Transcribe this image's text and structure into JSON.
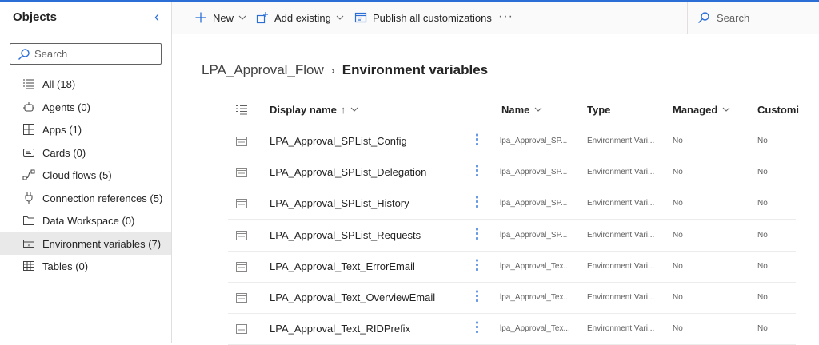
{
  "sidebar": {
    "title": "Objects",
    "search_placeholder": "Search",
    "items": [
      {
        "label": "All (18)",
        "icon": "list-icon"
      },
      {
        "label": "Agents (0)",
        "icon": "agent-icon"
      },
      {
        "label": "Apps (1)",
        "icon": "apps-icon"
      },
      {
        "label": "Cards (0)",
        "icon": "cards-icon"
      },
      {
        "label": "Cloud flows (5)",
        "icon": "flow-icon"
      },
      {
        "label": "Connection references (5)",
        "icon": "plug-icon"
      },
      {
        "label": "Data Workspace (0)",
        "icon": "folder-icon"
      },
      {
        "label": "Environment variables (7)",
        "icon": "env-variable-icon",
        "active": true
      },
      {
        "label": "Tables (0)",
        "icon": "table-icon"
      }
    ]
  },
  "toolbar": {
    "new_label": "New",
    "add_existing_label": "Add existing",
    "publish_label": "Publish all customizations",
    "more_label": "···",
    "search_placeholder": "Search"
  },
  "breadcrumb": {
    "parent": "LPA_Approval_Flow",
    "separator": "›",
    "current": "Environment variables"
  },
  "grid": {
    "columns": {
      "display_name": "Display name",
      "display_name_sort": "↑",
      "name": "Name",
      "type": "Type",
      "managed": "Managed",
      "customizable": "Customi"
    },
    "rows": [
      {
        "display_name": "LPA_Approval_SPList_Config",
        "name": "lpa_Approval_SP...",
        "type": "Environment Vari...",
        "managed": "No",
        "customizable": "No"
      },
      {
        "display_name": "LPA_Approval_SPList_Delegation",
        "name": "lpa_Approval_SP...",
        "type": "Environment Vari...",
        "managed": "No",
        "customizable": "No"
      },
      {
        "display_name": "LPA_Approval_SPList_History",
        "name": "lpa_Approval_SP...",
        "type": "Environment Vari...",
        "managed": "No",
        "customizable": "No"
      },
      {
        "display_name": "LPA_Approval_SPList_Requests",
        "name": "lpa_Approval_SP...",
        "type": "Environment Vari...",
        "managed": "No",
        "customizable": "No"
      },
      {
        "display_name": "LPA_Approval_Text_ErrorEmail",
        "name": "lpa_Approval_Tex...",
        "type": "Environment Vari...",
        "managed": "No",
        "customizable": "No"
      },
      {
        "display_name": "LPA_Approval_Text_OverviewEmail",
        "name": "lpa_Approval_Tex...",
        "type": "Environment Vari...",
        "managed": "No",
        "customizable": "No"
      },
      {
        "display_name": "LPA_Approval_Text_RIDPrefix",
        "name": "lpa_Approval_Tex...",
        "type": "Environment Vari...",
        "managed": "No",
        "customizable": "No"
      }
    ]
  },
  "colors": {
    "accent": "#2b6fd6",
    "active_item_bg": "#e9e9e9"
  }
}
